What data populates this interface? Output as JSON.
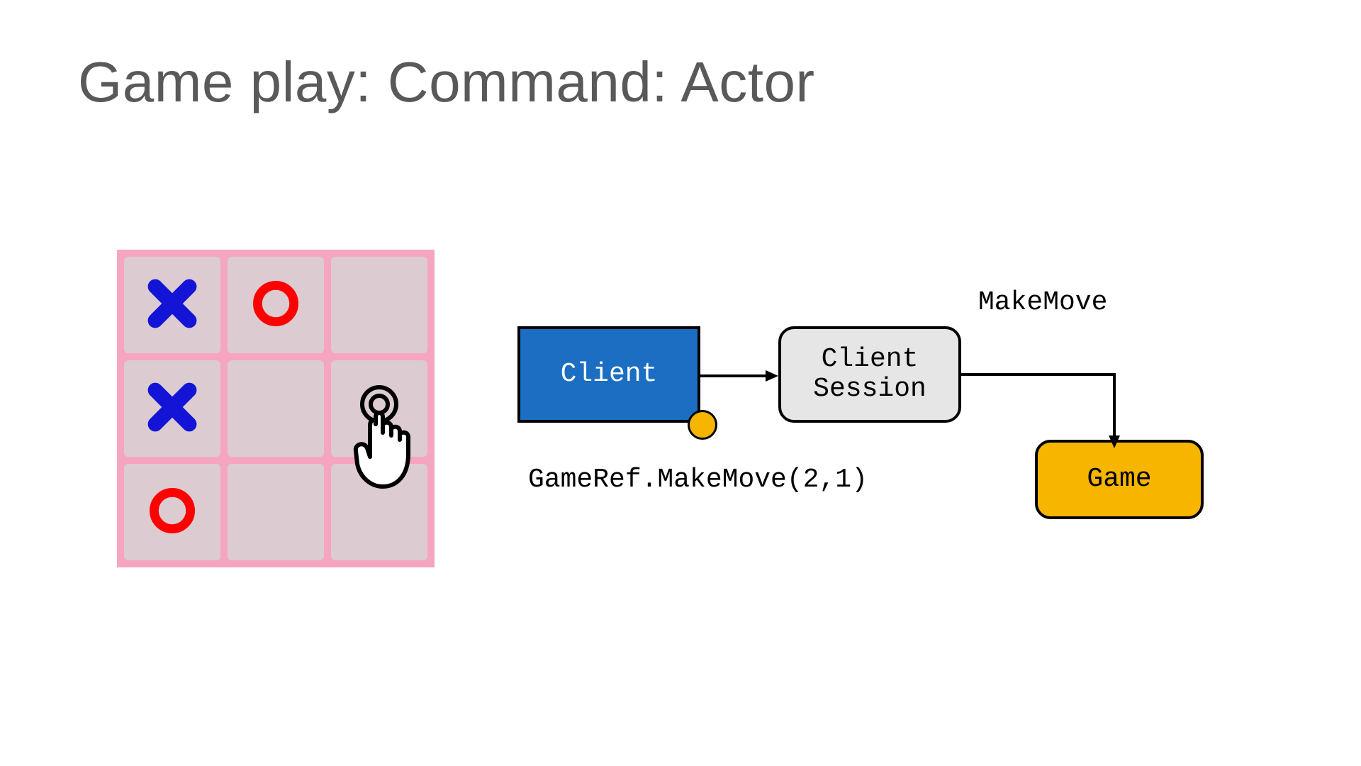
{
  "title": "Game play: Command: Actor",
  "board": {
    "cells": [
      {
        "mark": "x"
      },
      {
        "mark": "o"
      },
      {
        "mark": ""
      },
      {
        "mark": "x"
      },
      {
        "mark": ""
      },
      {
        "mark": "tap"
      },
      {
        "mark": "o"
      },
      {
        "mark": ""
      },
      {
        "mark": ""
      }
    ],
    "tap_cell_index": 5
  },
  "diagram": {
    "nodes": {
      "client": "Client",
      "session_line1": "Client",
      "session_line2": "Session",
      "game": "Game"
    },
    "labels": {
      "make_move": "MakeMove",
      "game_ref_call": "GameRef.MakeMove(2,1)"
    }
  },
  "colors": {
    "board_bg": "#f6a5c0",
    "cell_bg": "#dcccd2",
    "x_color": "#1414d6",
    "o_color": "#ff0000",
    "client_fill": "#1b6ec2",
    "session_fill": "#e6e6e6",
    "game_fill": "#f7b500",
    "port_fill": "#f7b500"
  }
}
